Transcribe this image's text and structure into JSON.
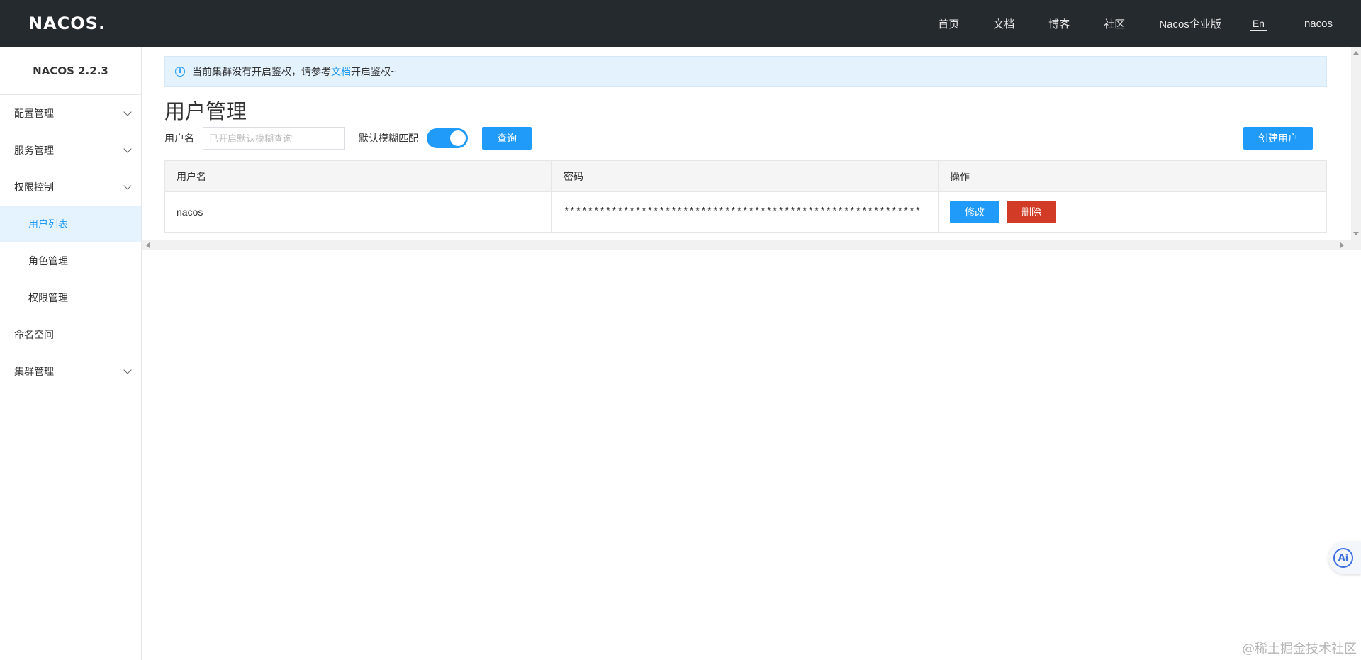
{
  "header": {
    "logo": "NACOS.",
    "nav": [
      "首页",
      "文档",
      "博客",
      "社区",
      "Nacos企业版"
    ],
    "lang": "En",
    "user": "nacos"
  },
  "sidebar": {
    "version": "NACOS 2.2.3",
    "items": [
      {
        "label": "配置管理",
        "expandable": true
      },
      {
        "label": "服务管理",
        "expandable": true
      },
      {
        "label": "权限控制",
        "expandable": true,
        "expanded": true
      },
      {
        "label": "用户列表",
        "sub": true,
        "active": true
      },
      {
        "label": "角色管理",
        "sub": true
      },
      {
        "label": "权限管理",
        "sub": true
      },
      {
        "label": "命名空间"
      },
      {
        "label": "集群管理",
        "expandable": true
      }
    ]
  },
  "notice": {
    "text_before": "当前集群没有开启鉴权，请参考",
    "link": "文档",
    "text_after": "开启鉴权~"
  },
  "page": {
    "title": "用户管理"
  },
  "filter": {
    "username_label": "用户名",
    "username_placeholder": "已开启默认模糊查询",
    "fuzzy_label": "默认模糊匹配",
    "fuzzy_on": true,
    "query_button": "查询",
    "create_button": "创建用户"
  },
  "table": {
    "headers": [
      "用户名",
      "密码",
      "操作"
    ],
    "rows": [
      {
        "username": "nacos",
        "password": "************************************************************",
        "edit": "修改",
        "delete": "删除"
      }
    ]
  },
  "ai": {
    "label": "Ai"
  },
  "watermark": "@稀土掘金技术社区",
  "colors": {
    "header_bg": "#252a2f",
    "primary": "#209bfa",
    "danger": "#d23c26",
    "active_bg": "#e5f3ff",
    "notice_bg": "#e3f2fd"
  }
}
